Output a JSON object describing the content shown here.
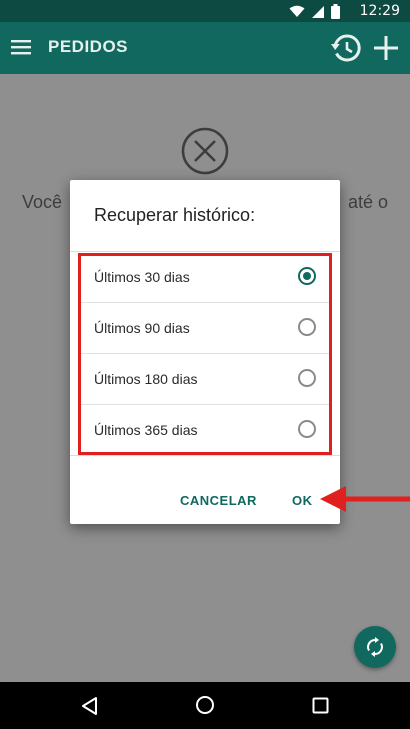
{
  "status_bar": {
    "time": "12:29"
  },
  "app_bar": {
    "title": "PEDIDOS",
    "icons": [
      "menu-icon",
      "history-icon",
      "add-icon"
    ]
  },
  "background": {
    "empty_text_left": "Você",
    "empty_text_right": "até o"
  },
  "dialog": {
    "title": "Recuperar histórico:",
    "options": [
      {
        "label": "Últimos 30 dias",
        "selected": true
      },
      {
        "label": "Últimos 90 dias",
        "selected": false
      },
      {
        "label": "Últimos 180 dias",
        "selected": false
      },
      {
        "label": "Últimos 365 dias",
        "selected": false
      }
    ],
    "cancel_label": "CANCELAR",
    "ok_label": "OK"
  },
  "colors": {
    "primary": "#11685e",
    "status_bar": "#0c4a42",
    "highlight": "#e0201e"
  }
}
